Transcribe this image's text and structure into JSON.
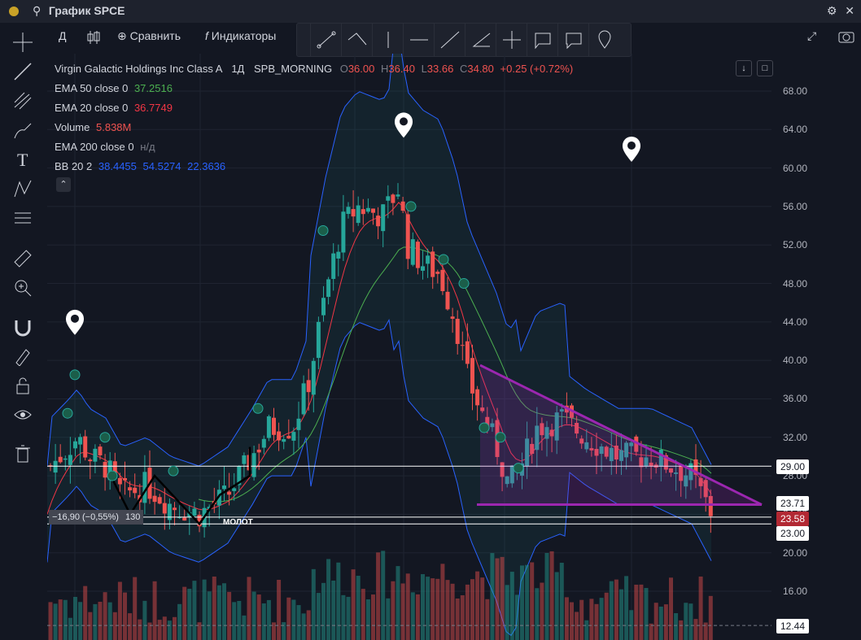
{
  "window": {
    "title": "График SPCE"
  },
  "toolbar": {
    "interval": "Д",
    "compare_label": "Сравнить",
    "indicators_label": "Индикаторы"
  },
  "legend": {
    "symbol": "Virgin Galactic Holdings Inc Class A",
    "interval": "1Д",
    "exchange": "SPB_MORNING",
    "o_label": "O",
    "o": "36.00",
    "h_label": "H",
    "h": "36.40",
    "l_label": "L",
    "l": "33.66",
    "c_label": "C",
    "c": "34.80",
    "change": "+0.25 (+0.72%)",
    "ema50_label": "EMA 50 close 0",
    "ema50": "37.2516",
    "ema20_label": "EMA 20 close 0",
    "ema20": "36.7749",
    "volume_label": "Volume",
    "volume": "5.838M",
    "ema200_label": "EMA 200 close 0",
    "ema200": "н/д",
    "bb_label": "BB 20 2",
    "bb1": "38.4455",
    "bb2": "54.5274",
    "bb3": "22.3636"
  },
  "price_axis": [
    "68.00",
    "64.00",
    "60.00",
    "56.00",
    "52.00",
    "48.00",
    "44.00",
    "40.00",
    "36.00",
    "32.00",
    "28.00",
    "24.00",
    "20.00",
    "16.00"
  ],
  "price_tags": {
    "t1": "29.00",
    "t2": "23.71",
    "t3": "23.58",
    "t4": "23.00",
    "t5": "12.44"
  },
  "measure": {
    "delta": "−16,90 (−0,55%)",
    "bars": "130"
  },
  "annotation": {
    "hammer": "МОЛОТ"
  },
  "colors": {
    "up": "#26a69a",
    "down": "#ef5350",
    "triangle": "#9c27b0",
    "bb": "#2962ff",
    "ema20": "#f23645",
    "ema50": "#4caf50"
  }
}
